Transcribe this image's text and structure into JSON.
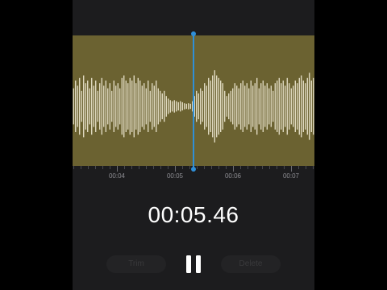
{
  "waveform": {
    "background_color": "#6b6231",
    "bar_color": "#f2eed8",
    "amplitudes": [
      0.35,
      0.5,
      0.4,
      0.55,
      0.3,
      0.6,
      0.45,
      0.5,
      0.35,
      0.55,
      0.4,
      0.5,
      0.3,
      0.45,
      0.55,
      0.4,
      0.5,
      0.35,
      0.45,
      0.3,
      0.5,
      0.4,
      0.45,
      0.35,
      0.55,
      0.6,
      0.5,
      0.45,
      0.55,
      0.5,
      0.6,
      0.45,
      0.55,
      0.5,
      0.4,
      0.45,
      0.35,
      0.5,
      0.3,
      0.45,
      0.4,
      0.5,
      0.35,
      0.3,
      0.25,
      0.3,
      0.2,
      0.15,
      0.12,
      0.1,
      0.12,
      0.1,
      0.08,
      0.1,
      0.08,
      0.06,
      0.05,
      0.06,
      0.05,
      0.1,
      0.2,
      0.3,
      0.25,
      0.35,
      0.3,
      0.45,
      0.4,
      0.55,
      0.5,
      0.6,
      0.7,
      0.6,
      0.55,
      0.5,
      0.45,
      0.3,
      0.2,
      0.25,
      0.3,
      0.35,
      0.45,
      0.4,
      0.35,
      0.45,
      0.5,
      0.4,
      0.45,
      0.35,
      0.5,
      0.4,
      0.45,
      0.55,
      0.35,
      0.45,
      0.5,
      0.4,
      0.45,
      0.35,
      0.4,
      0.3,
      0.45,
      0.5,
      0.55,
      0.45,
      0.5,
      0.4,
      0.55,
      0.45,
      0.35,
      0.4,
      0.5,
      0.45,
      0.55,
      0.6,
      0.5,
      0.45,
      0.55,
      0.65,
      0.5,
      0.55
    ]
  },
  "timeline": {
    "labels": [
      "00:04",
      "00:05",
      "00:06",
      "00:07"
    ]
  },
  "playhead": {
    "color": "#2f8fd8"
  },
  "recorder": {
    "elapsed_time": "00:05.46",
    "trim_label": "Trim",
    "delete_label": "Delete",
    "pause_icon": "pause-icon"
  }
}
